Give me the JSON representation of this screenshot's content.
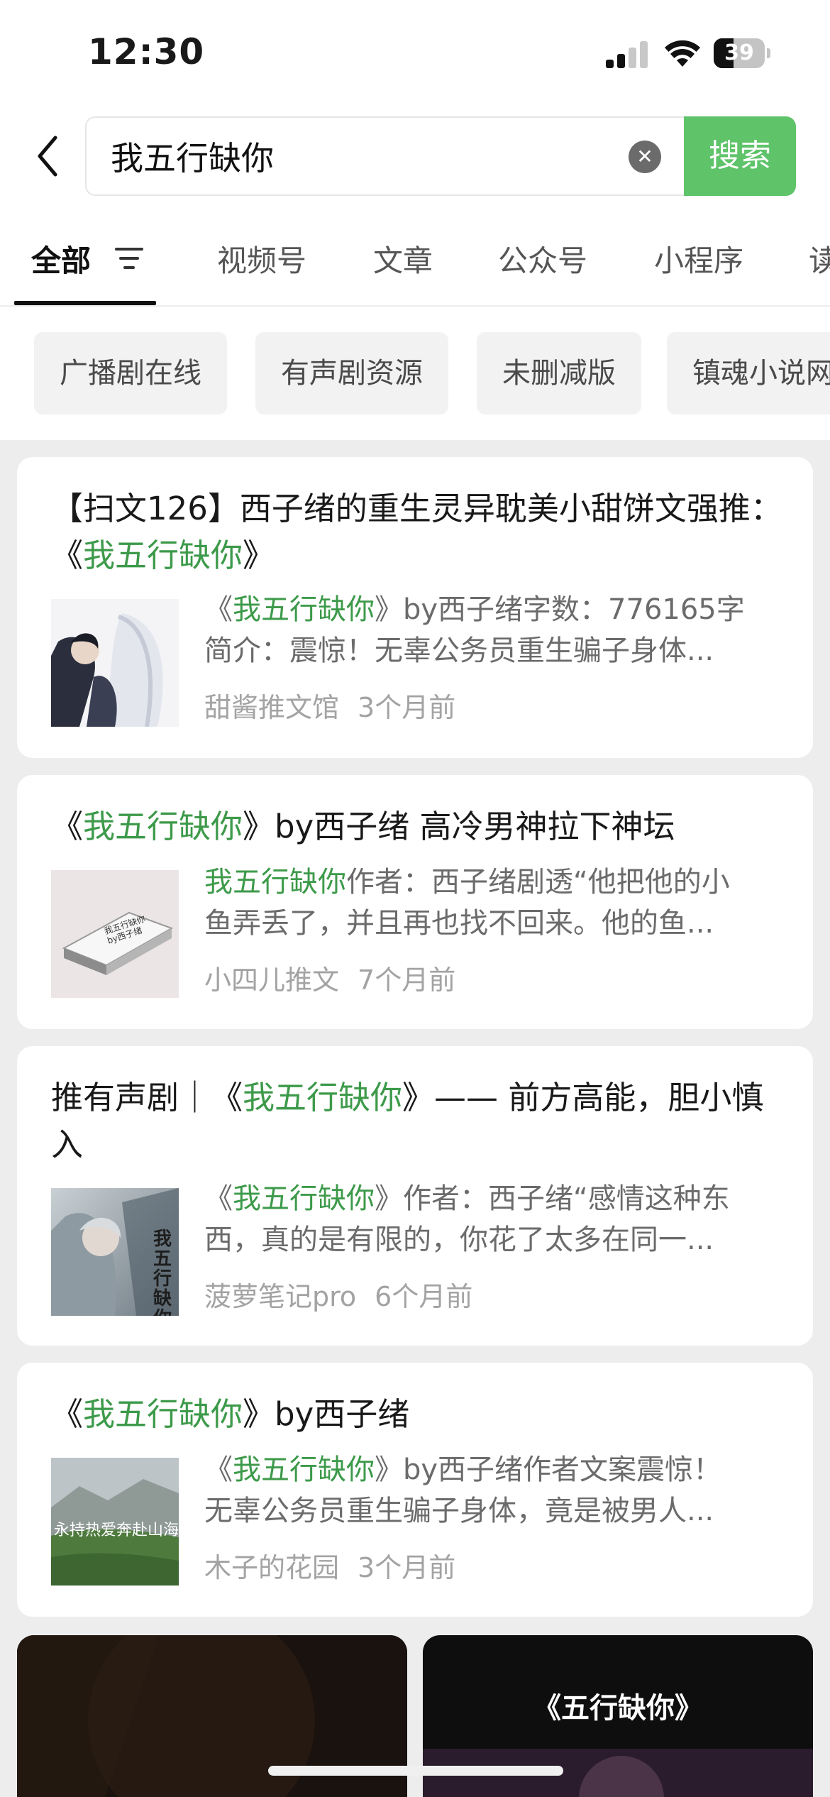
{
  "status_bar": {
    "time": "12:30",
    "battery": "39",
    "battery_level": 0.39
  },
  "search": {
    "query": "我五行缺你",
    "button_label": "搜索"
  },
  "tabs": [
    {
      "label": "全部",
      "active": true
    },
    {
      "label": "视频号"
    },
    {
      "label": "文章"
    },
    {
      "label": "公众号"
    },
    {
      "label": "小程序"
    },
    {
      "label": "读"
    }
  ],
  "chips": [
    "广播剧在线",
    "有声剧资源",
    "未删减版",
    "镇魂小说网"
  ],
  "results": [
    {
      "title_pre": "【扫文126】西子绪的重生灵异耽美小甜饼文强推：《",
      "title_hl": "我五行缺你",
      "title_post": "》",
      "desc1_pre": "《",
      "desc1_hl": "我五行缺你",
      "desc1_post": "》by西子绪字数：776165字",
      "desc2": "简介：震惊！无辜公务员重生骗子身体...",
      "source": "甜酱推文馆",
      "time": "3个月前"
    },
    {
      "title_pre": "《",
      "title_hl": "我五行缺你",
      "title_post": "》by西子绪 高冷男神拉下神坛",
      "desc1_pre": "",
      "desc1_hl": "我五行缺你",
      "desc1_post": "作者：西子绪剧透“他把他的小",
      "desc2": "鱼弄丢了，并且再也找不回来。他的鱼...",
      "source": "小四儿推文",
      "time": "7个月前",
      "thumb_text1": "我五行缺你",
      "thumb_text2": "by西子绪"
    },
    {
      "title_pre": "推有声剧｜《",
      "title_hl": "我五行缺你",
      "title_post": "》—— 前方高能，胆小慎入",
      "desc1_pre": "《",
      "desc1_hl": "我五行缺你",
      "desc1_post": "》作者：西子绪“感情这种东",
      "desc2": "西，真的是有限的，你花了太多在同一...",
      "source": "菠萝笔记pro",
      "time": "6个月前",
      "thumb_text": "我五行缺你"
    },
    {
      "title_pre": "《",
      "title_hl": "我五行缺你",
      "title_post": "》by西子绪",
      "desc1_pre": "《",
      "desc1_hl": "我五行缺你",
      "desc1_post": "》by西子绪作者文案震惊！",
      "desc2": "无辜公务员重生骗子身体，竟是被男人...",
      "source": "木子的花园",
      "time": "3个月前",
      "thumb_text1": "永持热爱",
      "thumb_text2": "奔赴山海"
    }
  ],
  "videos": [
    {
      "caption": ""
    },
    {
      "caption": "《五行缺你》"
    }
  ],
  "colors": {
    "accent": "#5fc36a",
    "highlight": "#3d9a4a",
    "background": "#ededed"
  }
}
